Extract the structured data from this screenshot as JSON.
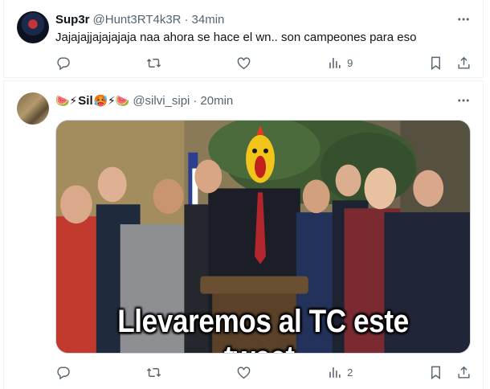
{
  "tweets": [
    {
      "display_name": "Sup3r",
      "handle": "@Hunt3RT4k3R",
      "separator": "·",
      "time": "34min",
      "text": "Jajajajjajajajaja naa ahora se hace el wn.. son campeones para eso",
      "views": "9"
    },
    {
      "name_prefix_emoji": "🍉⚡",
      "display_name": "Sil",
      "name_suffix_emoji": "🥵⚡🍉",
      "handle": "@silvi_sipi",
      "separator": "·",
      "time": "20min",
      "media_caption": "Llevaremos al TC este tweet.",
      "views": "2"
    }
  ],
  "icons": [
    "more-icon",
    "reply-icon",
    "retweet-icon",
    "like-icon",
    "views-icon",
    "bookmark-icon",
    "share-icon"
  ],
  "colors": {
    "secondary_text": "#536471",
    "primary_text": "#0f1419",
    "divider": "#eff3f4"
  }
}
